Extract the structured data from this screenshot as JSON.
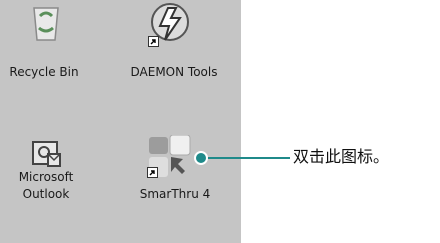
{
  "desktop": {
    "background": "#c5c5c5",
    "icons": [
      {
        "label": "Recycle Bin",
        "icon": "recycle-bin-icon"
      },
      {
        "label": "DAEMON Tools",
        "icon": "daemon-tools-icon"
      },
      {
        "label_line1": "Microsoft",
        "label_line2": "Outlook",
        "icon": "outlook-icon"
      },
      {
        "label": "SmarThru 4",
        "icon": "smarthru-icon"
      }
    ]
  },
  "callout": {
    "text": "双击此图标。",
    "color": "#1f8a8a"
  }
}
